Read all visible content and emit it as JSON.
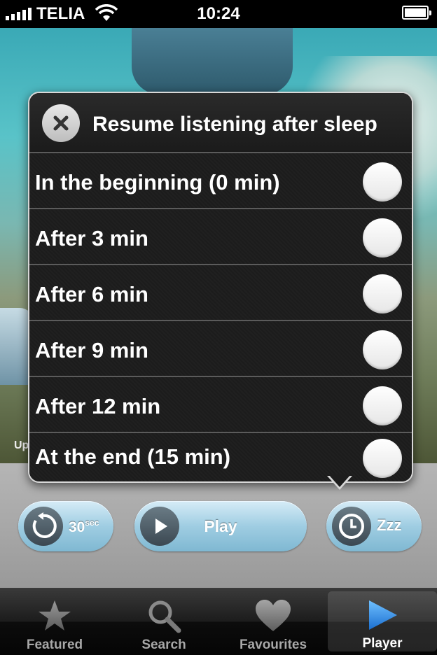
{
  "status_bar": {
    "carrier": "TELIA",
    "time": "10:24"
  },
  "artwork": {
    "partial_text": "Up"
  },
  "popover": {
    "title": "Resume listening after sleep",
    "options": [
      {
        "label": "In the beginning (0 min)",
        "selected": false
      },
      {
        "label": "After 3 min",
        "selected": false
      },
      {
        "label": "After 6 min",
        "selected": false
      },
      {
        "label": "After 9 min",
        "selected": false
      },
      {
        "label": "After 12 min",
        "selected": false
      },
      {
        "label": "At the end (15 min)",
        "selected": false
      }
    ]
  },
  "controls": {
    "replay_label": "30",
    "replay_unit": "sec",
    "play_label": "Play",
    "sleep_label": "Zzz"
  },
  "tab_bar": {
    "tabs": [
      {
        "label": "Featured",
        "icon": "star-icon",
        "active": false
      },
      {
        "label": "Search",
        "icon": "magnifier-icon",
        "active": false
      },
      {
        "label": "Favourites",
        "icon": "heart-icon",
        "active": false
      },
      {
        "label": "Player",
        "icon": "play-triangle-icon",
        "active": true
      }
    ]
  },
  "colors": {
    "accent_blue": "#2f8de0",
    "button_blue": "#9fcde2"
  }
}
